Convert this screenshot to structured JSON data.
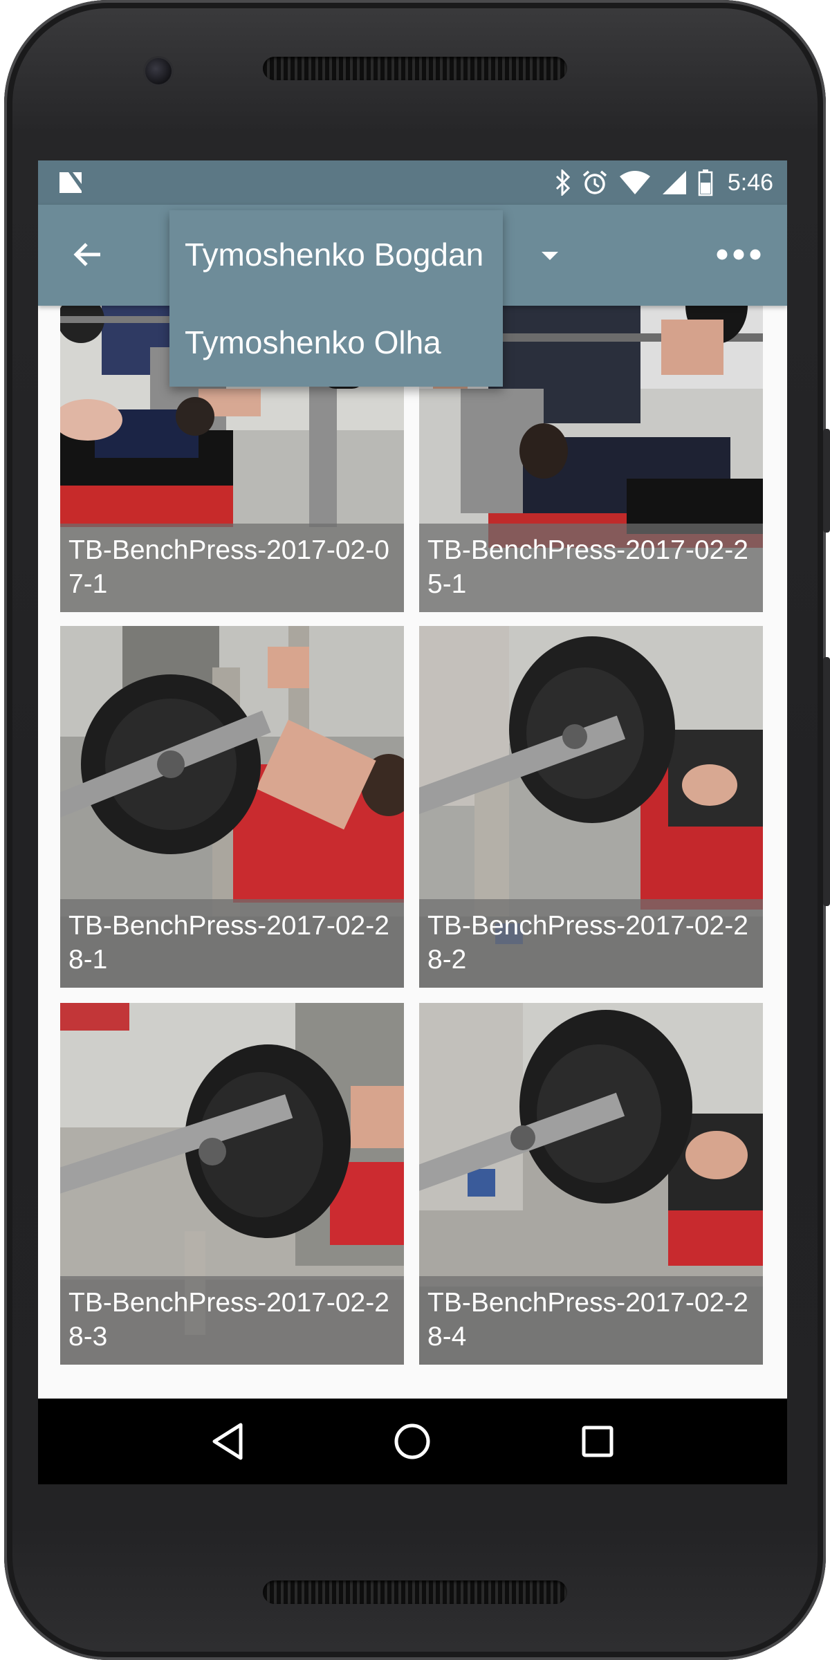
{
  "status_bar": {
    "time": "5:46",
    "icons": [
      "n-logo-icon",
      "bluetooth-icon",
      "alarm-icon",
      "wifi-icon",
      "signal-icon",
      "battery-icon"
    ]
  },
  "toolbar": {
    "back_icon": "arrow-back-icon",
    "spinner_icon": "dropdown-arrow-icon",
    "overflow_icon": "more-dots-icon",
    "background": "#6c8b98"
  },
  "dropdown": {
    "items": [
      {
        "label": "Tymoshenko Bogdan"
      },
      {
        "label": "Tymoshenko Olha"
      }
    ]
  },
  "gallery": {
    "items": [
      {
        "caption": "TB-BenchPress-2017-02-07-1"
      },
      {
        "caption": "TB-BenchPress-2017-02-25-1"
      },
      {
        "caption": "TB-BenchPress-2017-02-28-1"
      },
      {
        "caption": "TB-BenchPress-2017-02-28-2"
      },
      {
        "caption": "TB-BenchPress-2017-02-28-3"
      },
      {
        "caption": "TB-BenchPress-2017-02-28-4"
      }
    ]
  },
  "nav_bar": {
    "icons": [
      "back-triangle-icon",
      "home-circle-icon",
      "recents-square-icon"
    ]
  }
}
